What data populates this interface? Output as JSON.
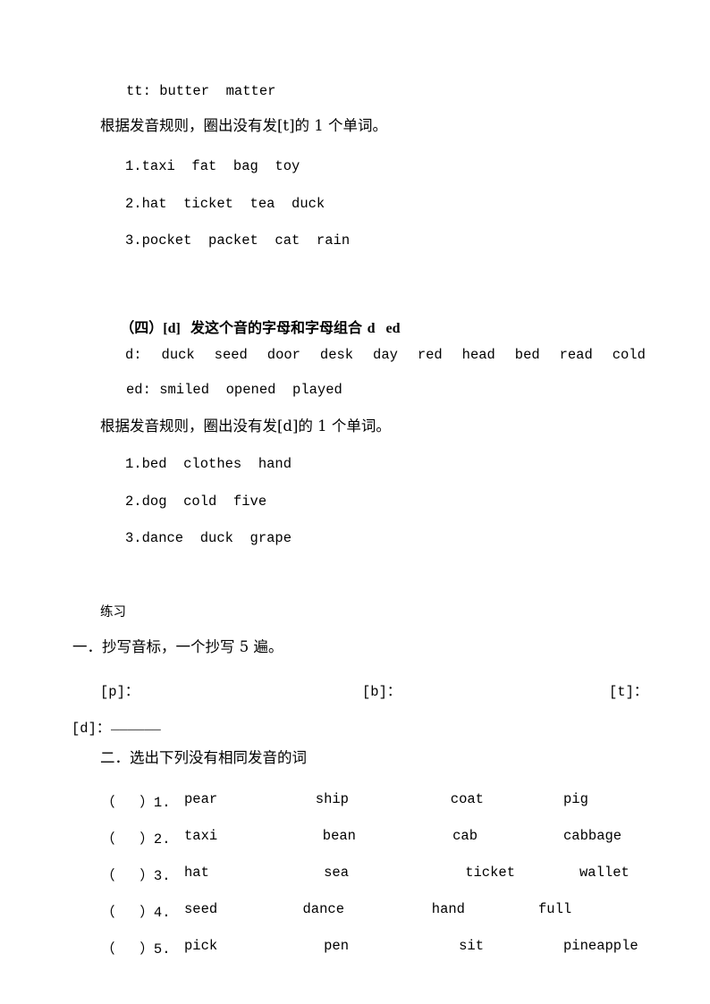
{
  "document": {
    "language": "zh-CN",
    "background_color": "#ffffff",
    "text_color": "#000000"
  },
  "section_t": {
    "examples_line": "tt: butter  matter",
    "instruction": "根据发音规则，圈出没有发[t]的 1 个单词。",
    "items": [
      "1.taxi  fat  bag  toy",
      "2.hat  ticket  tea  duck",
      "3.pocket  packet  cat  rain"
    ]
  },
  "section_d": {
    "heading_cjk_prefix": "（四）",
    "heading_ipa": "[d]",
    "heading_text": "  发这个音的字母和字母组合 ",
    "heading_letters": "d   ed",
    "d_label": "d:",
    "d_words": [
      "duck",
      "seed",
      "door",
      "desk",
      "day",
      "red",
      "head",
      "bed",
      "read",
      "cold"
    ],
    "ed_line": "ed: smiled  opened  played",
    "instruction": "根据发音规则，圈出没有发[d]的 1 个单词。",
    "items": [
      "1.bed  clothes  hand",
      "2.dog  cold  five",
      "3.dance  duck  grape"
    ]
  },
  "exercises": {
    "title": "练习",
    "part_one": {
      "heading": "一．抄写音标，一个抄写 5 遍。",
      "ipa_slots": [
        {
          "label": "[p]："
        },
        {
          "label": "[b]："
        },
        {
          "label": "[t]："
        }
      ],
      "ipa_slot_d": "[d]：",
      "ipa_slot_d_blank": "______"
    },
    "part_two": {
      "heading": "二．选出下列没有相同发音的词",
      "rows": [
        {
          "bracket": "（   ）",
          "number": "1.",
          "col1": "pear",
          "col2": "ship",
          "col3": "coat",
          "col4": "pig"
        },
        {
          "bracket": "（   ）",
          "number": "2.",
          "col1": "taxi",
          "col2": "bean",
          "col3": "cab",
          "col4": "cabbage"
        },
        {
          "bracket": "（   ）",
          "number": "3.",
          "col1": "hat",
          "col2": "sea",
          "col3": "ticket",
          "col4": "wallet"
        },
        {
          "bracket": "（   ）",
          "number": "4.",
          "col1": "seed",
          "col2": "dance",
          "col3": "hand",
          "col4": "full"
        },
        {
          "bracket": "（   ）",
          "number": "5.",
          "col1": "pick",
          "col2": "pen",
          "col3": "sit",
          "col4": "pineapple"
        }
      ]
    }
  }
}
